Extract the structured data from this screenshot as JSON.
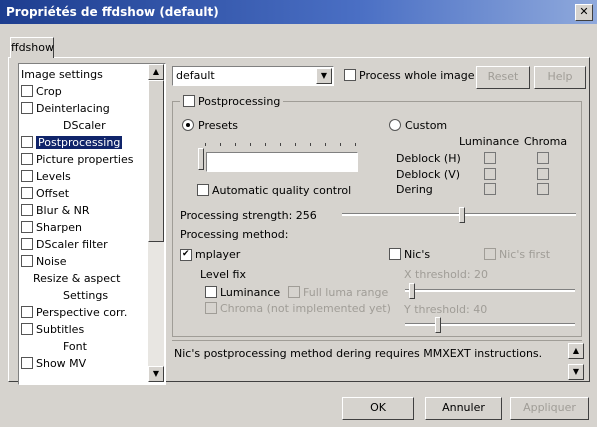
{
  "window": {
    "title": "Propriétés de ffdshow (default)",
    "close": "✕"
  },
  "tab": {
    "label": "ffdshow"
  },
  "sidebar": {
    "items": [
      {
        "label": "Image settings",
        "checkbox": false,
        "indent": 0
      },
      {
        "label": "Crop",
        "checkbox": true,
        "checked": false,
        "indent": 0
      },
      {
        "label": "Deinterlacing",
        "checkbox": true,
        "checked": false,
        "indent": 0
      },
      {
        "label": "DScaler",
        "checkbox": false,
        "indent": 2
      },
      {
        "label": "Postprocessing",
        "checkbox": true,
        "checked": false,
        "indent": 0,
        "selected": true
      },
      {
        "label": "Picture properties",
        "checkbox": true,
        "checked": false,
        "indent": 0
      },
      {
        "label": "Levels",
        "checkbox": true,
        "checked": false,
        "indent": 0
      },
      {
        "label": "Offset",
        "checkbox": true,
        "checked": false,
        "indent": 0
      },
      {
        "label": "Blur & NR",
        "checkbox": true,
        "checked": false,
        "indent": 0
      },
      {
        "label": "Sharpen",
        "checkbox": true,
        "checked": false,
        "indent": 0
      },
      {
        "label": "DScaler filter",
        "checkbox": true,
        "checked": false,
        "indent": 0
      },
      {
        "label": "Noise",
        "checkbox": true,
        "checked": false,
        "indent": 0
      },
      {
        "label": "Resize & aspect",
        "checkbox": false,
        "indent": 1
      },
      {
        "label": "Settings",
        "checkbox": false,
        "indent": 2
      },
      {
        "label": "Perspective corr.",
        "checkbox": true,
        "checked": false,
        "indent": 0
      },
      {
        "label": "Subtitles",
        "checkbox": true,
        "checked": false,
        "indent": 0
      },
      {
        "label": "Font",
        "checkbox": false,
        "indent": 2
      },
      {
        "label": "Show MV",
        "checkbox": true,
        "checked": false,
        "indent": 0
      }
    ]
  },
  "toolbar": {
    "preset_value": "default",
    "process_whole_image": "Process whole image",
    "reset": "Reset",
    "help": "Help"
  },
  "postprocessing": {
    "group_label": "Postprocessing",
    "presets_label": "Presets",
    "custom_label": "Custom",
    "luminance_header": "Luminance",
    "chroma_header": "Chroma",
    "deblock_h": "Deblock (H)",
    "deblock_v": "Deblock (V)",
    "dering": "Dering",
    "auto_quality": "Automatic quality control",
    "strength_label": "Processing strength: 256",
    "strength_value": 256,
    "strength_max": 256,
    "method_label": "Processing method:",
    "mplayer_label": "mplayer",
    "nics_label": "Nic's",
    "nics_first_label": "Nic's first",
    "level_fix_label": "Level fix",
    "luminance_label": "Luminance",
    "full_luma_label": "Full luma range",
    "chroma_label": "Chroma (not implemented yet)",
    "x_threshold_label": "X threshold: 20",
    "y_threshold_label": "Y threshold: 40"
  },
  "status": {
    "message": "Nic's postprocessing method dering requires MMXEXT instructions."
  },
  "footer": {
    "ok": "OK",
    "cancel": "Annuler",
    "apply": "Appliquer"
  }
}
